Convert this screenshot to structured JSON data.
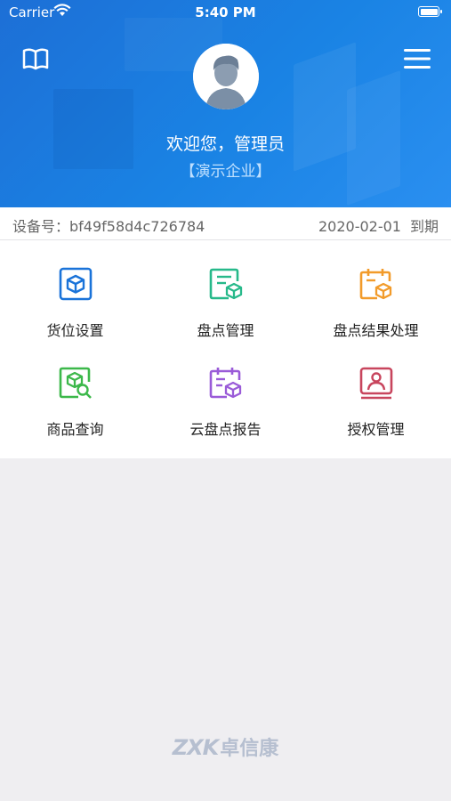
{
  "status_bar": {
    "carrier": "Carrier",
    "time": "5:40 PM"
  },
  "header": {
    "welcome": "欢迎您，管理员",
    "company": "【演示企业】"
  },
  "device": {
    "label": "设备号：bf49f58d4c726784",
    "expire_date": "2020-02-01",
    "expire_text": "到期"
  },
  "menu": [
    {
      "label": "货位设置",
      "icon": "box-icon",
      "color": "#1a73d9"
    },
    {
      "label": "盘点管理",
      "icon": "document-box-icon",
      "color": "#27b98a"
    },
    {
      "label": "盘点结果处理",
      "icon": "calendar-box-icon",
      "color": "#f29b2a"
    },
    {
      "label": "商品查询",
      "icon": "box-search-icon",
      "color": "#3cb84a"
    },
    {
      "label": "云盘点报告",
      "icon": "calendar-report-icon",
      "color": "#9a5bd8"
    },
    {
      "label": "授权管理",
      "icon": "user-card-icon",
      "color": "#c8455d"
    }
  ],
  "footer": {
    "brand_mark": "ZXK",
    "brand_name": "卓信康"
  },
  "colors": {
    "header_blue": "#1a7be0",
    "background": "#efeef1"
  }
}
